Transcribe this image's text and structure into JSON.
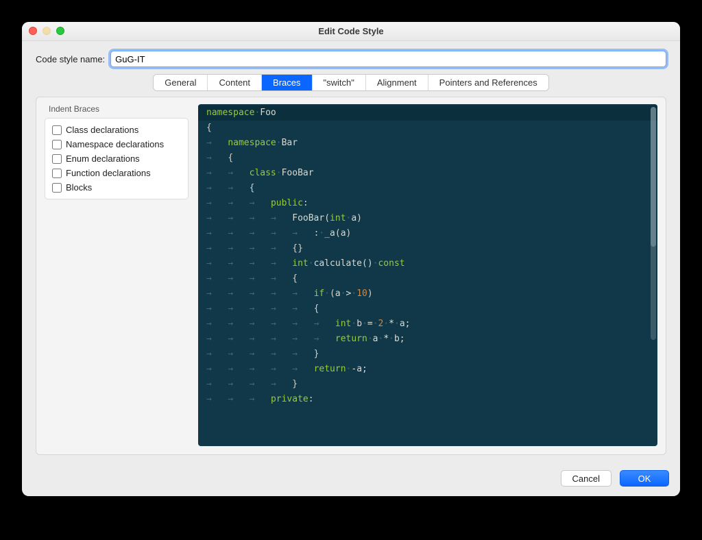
{
  "window": {
    "title": "Edit Code Style"
  },
  "name_field": {
    "label": "Code style name:",
    "value": "GuG-IT"
  },
  "tabs": {
    "items": [
      {
        "label": "General",
        "active": false
      },
      {
        "label": "Content",
        "active": false
      },
      {
        "label": "Braces",
        "active": true
      },
      {
        "label": "\"switch\"",
        "active": false
      },
      {
        "label": "Alignment",
        "active": false
      },
      {
        "label": "Pointers and References",
        "active": false
      }
    ]
  },
  "indent_braces": {
    "group_label": "Indent Braces",
    "options": [
      {
        "label": "Class declarations",
        "checked": false
      },
      {
        "label": "Namespace declarations",
        "checked": false
      },
      {
        "label": "Enum declarations",
        "checked": false
      },
      {
        "label": "Function declarations",
        "checked": false
      },
      {
        "label": "Blocks",
        "checked": false
      }
    ]
  },
  "buttons": {
    "cancel": "Cancel",
    "ok": "OK"
  },
  "code": {
    "arrow": "→",
    "mid": "·",
    "lines": [
      {
        "hl": true,
        "indent": 0,
        "tokens": [
          [
            "kw",
            "namespace"
          ],
          [
            "dot",
            "·"
          ],
          [
            "ident",
            "Foo"
          ]
        ]
      },
      {
        "hl": false,
        "indent": 0,
        "tokens": [
          [
            "punct",
            "{"
          ]
        ]
      },
      {
        "hl": false,
        "indent": 1,
        "tokens": [
          [
            "kw",
            "namespace"
          ],
          [
            "dot",
            "·"
          ],
          [
            "ident",
            "Bar"
          ]
        ]
      },
      {
        "hl": false,
        "indent": 1,
        "tokens": [
          [
            "punct",
            "{"
          ]
        ]
      },
      {
        "hl": false,
        "indent": 2,
        "tokens": [
          [
            "kw",
            "class"
          ],
          [
            "dot",
            "·"
          ],
          [
            "ident",
            "FooBar"
          ]
        ]
      },
      {
        "hl": false,
        "indent": 2,
        "tokens": [
          [
            "punct",
            "{"
          ]
        ]
      },
      {
        "hl": false,
        "indent": 3,
        "tokens": [
          [
            "kw",
            "public"
          ],
          [
            "punct",
            ":"
          ]
        ]
      },
      {
        "hl": false,
        "indent": 4,
        "tokens": [
          [
            "ident",
            "FooBar("
          ],
          [
            "kw",
            "int"
          ],
          [
            "dot",
            "·"
          ],
          [
            "ident",
            "a)"
          ]
        ]
      },
      {
        "hl": false,
        "indent": 5,
        "tokens": [
          [
            "punct",
            ":"
          ],
          [
            "dot",
            "·"
          ],
          [
            "ident",
            "_a(a)"
          ]
        ]
      },
      {
        "hl": false,
        "indent": 4,
        "tokens": [
          [
            "punct",
            "{}"
          ]
        ]
      },
      {
        "hl": false,
        "indent": 4,
        "tokens": [
          [
            "kw",
            "int"
          ],
          [
            "dot",
            "·"
          ],
          [
            "ident",
            "calculate()"
          ],
          [
            "dot",
            "·"
          ],
          [
            "kw",
            "const"
          ]
        ]
      },
      {
        "hl": false,
        "indent": 4,
        "tokens": [
          [
            "punct",
            "{"
          ]
        ]
      },
      {
        "hl": false,
        "indent": 5,
        "tokens": [
          [
            "kw",
            "if"
          ],
          [
            "dot",
            "·"
          ],
          [
            "punct",
            "("
          ],
          [
            "ident",
            "a"
          ],
          [
            "dot",
            "·"
          ],
          [
            "op",
            ">"
          ],
          [
            "dot",
            "·"
          ],
          [
            "num",
            "10"
          ],
          [
            "punct",
            ")"
          ]
        ]
      },
      {
        "hl": false,
        "indent": 5,
        "tokens": [
          [
            "punct",
            "{"
          ]
        ]
      },
      {
        "hl": false,
        "indent": 6,
        "tokens": [
          [
            "kw",
            "int"
          ],
          [
            "dot",
            "·"
          ],
          [
            "ident",
            "b"
          ],
          [
            "dot",
            "·"
          ],
          [
            "op",
            "="
          ],
          [
            "dot",
            "·"
          ],
          [
            "num",
            "2"
          ],
          [
            "dot",
            "·"
          ],
          [
            "op",
            "*"
          ],
          [
            "dot",
            "·"
          ],
          [
            "ident",
            "a;"
          ]
        ]
      },
      {
        "hl": false,
        "indent": 6,
        "tokens": [
          [
            "kw",
            "return"
          ],
          [
            "dot",
            "·"
          ],
          [
            "ident",
            "a"
          ],
          [
            "dot",
            "·"
          ],
          [
            "op",
            "*"
          ],
          [
            "dot",
            "·"
          ],
          [
            "ident",
            "b;"
          ]
        ]
      },
      {
        "hl": false,
        "indent": 5,
        "tokens": [
          [
            "punct",
            "}"
          ]
        ]
      },
      {
        "hl": false,
        "indent": 5,
        "tokens": [
          [
            "kw",
            "return"
          ],
          [
            "dot",
            "·"
          ],
          [
            "op",
            "-"
          ],
          [
            "ident",
            "a;"
          ]
        ]
      },
      {
        "hl": false,
        "indent": 4,
        "tokens": [
          [
            "punct",
            "}"
          ]
        ]
      },
      {
        "hl": false,
        "indent": 3,
        "tokens": [
          [
            "kw",
            "private"
          ],
          [
            "punct",
            ":"
          ]
        ]
      }
    ]
  }
}
